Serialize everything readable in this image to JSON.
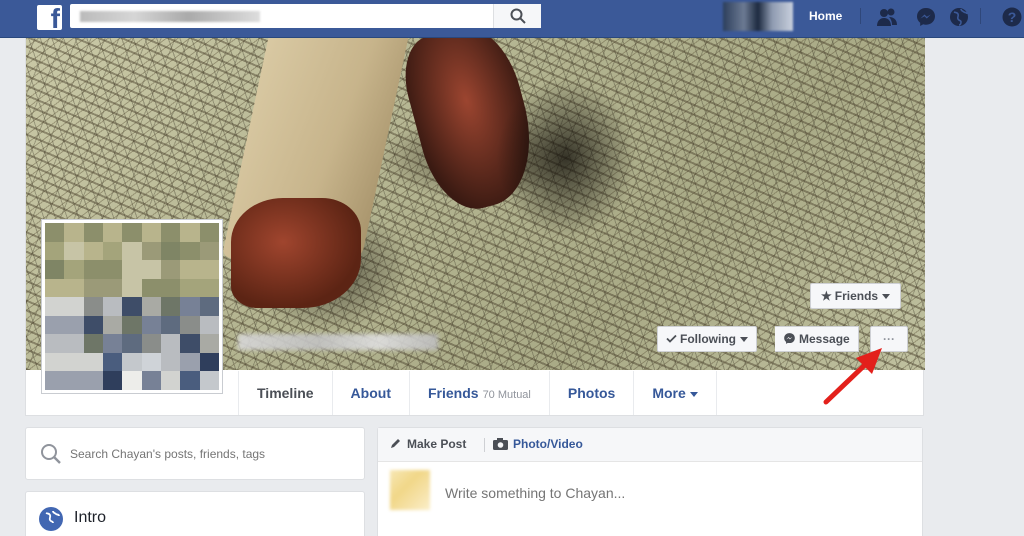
{
  "topbar": {
    "logo": "f",
    "search_value": "",
    "home_label": "Home",
    "icons": [
      "friend-requests-icon",
      "messenger-icon",
      "notifications-globe-icon",
      "help-icon"
    ]
  },
  "profile": {
    "action_buttons": {
      "friends_label": "Friends",
      "following_label": "Following",
      "message_label": "Message",
      "more_label": "···"
    },
    "nav": [
      {
        "label": "Timeline",
        "sub": ""
      },
      {
        "label": "About",
        "sub": ""
      },
      {
        "label": "Friends",
        "sub": "70 Mutual"
      },
      {
        "label": "Photos",
        "sub": ""
      },
      {
        "label": "More",
        "sub": ""
      }
    ]
  },
  "left_column": {
    "search_placeholder": "Search Chayan's posts, friends, tags",
    "intro_label": "Intro"
  },
  "composer": {
    "make_post_label": "Make Post",
    "photo_video_label": "Photo/Video",
    "placeholder": "Write something to Chayan..."
  },
  "colors": {
    "brand_blue": "#3b5998",
    "link_blue": "#365899",
    "annotation_arrow": "#e3201b"
  }
}
